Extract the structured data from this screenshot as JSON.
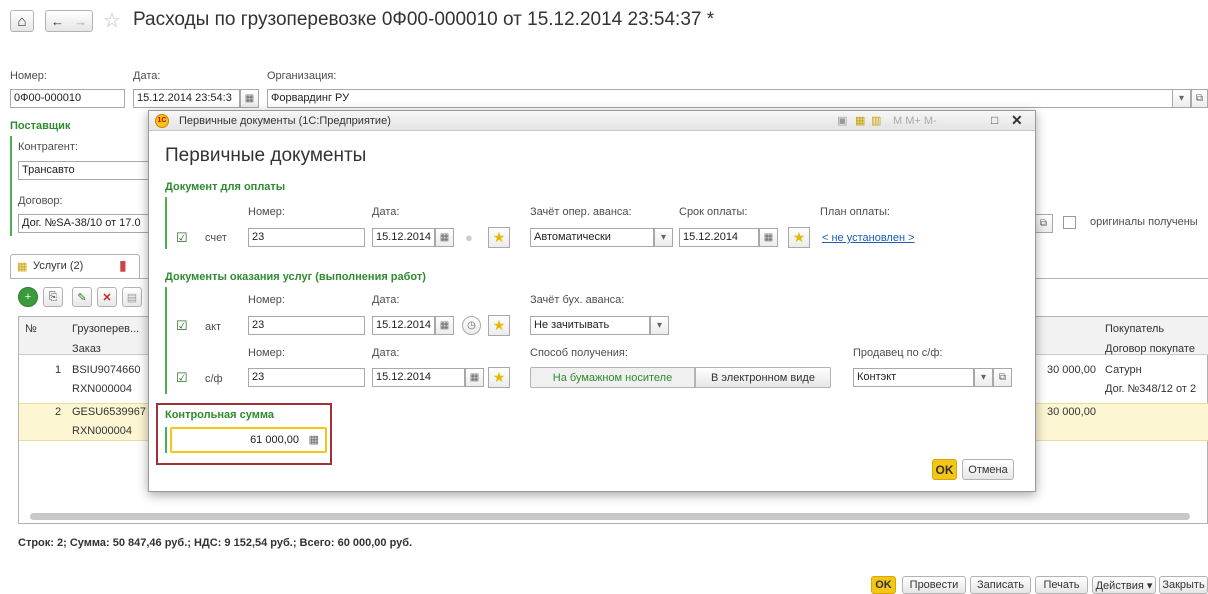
{
  "window": {
    "title": "Расходы по грузоперевозке 0Ф00-000010 от 15.12.2014 23:54:37 *",
    "home_icon": "⌂",
    "back_icon": "←",
    "forward_icon": "→",
    "star_icon": "☆"
  },
  "form": {
    "number_label": "Номер:",
    "number_value": "0Ф00-000010",
    "date_label": "Дата:",
    "date_value": "15.12.2014 23:54:3",
    "org_label": "Организация:",
    "org_value": "Форвардинг РУ",
    "supplier_header": "Поставщик",
    "counterparty_label": "Контрагент:",
    "counterparty_value": "Трансавто",
    "contract_label": "Договор:",
    "contract_value": "Дог. №SA-38/10 от 17.0",
    "originals_label": "оригиналы получены"
  },
  "tabs": [
    {
      "label": "Услуги (2)"
    }
  ],
  "table": {
    "col_num": "№",
    "col_cargo": "Грузоперев...",
    "col_order": "Заказ",
    "col_buyer": "Покупатель",
    "col_buyer_contract": "Договор покупате",
    "rows": [
      {
        "num": "1",
        "cargo": "BSIU9074660",
        "order": "RXN000004",
        "amount": "30 000,00",
        "buyer": "Сатурн",
        "buyer_contract": "Дог. №348/12 от 2"
      },
      {
        "num": "2",
        "cargo": "GESU6539967",
        "order": "RXN000004",
        "amount": "30 000,00",
        "buyer": "",
        "buyer_contract": ""
      }
    ]
  },
  "footer": {
    "totals": "Строк: 2;  Сумма: 50 847,46 руб.;  НДС: 9 152,54 руб.;  Всего: 60 000,00 руб.",
    "ok": "OK",
    "post": "Провести",
    "save": "Записать",
    "print": "Печать",
    "actions": "Действия ▾",
    "close": "Закрыть"
  },
  "dialog": {
    "titlebar": "Первичные документы (1С:Предприятие)",
    "titlebar_tools": "M  M+  M-",
    "heading": "Первичные документы",
    "payment_section": "Документ для оплаты",
    "number_label": "Номер:",
    "date_label": "Дата:",
    "advance_label": "Зачёт опер. аванса:",
    "due_label": "Срок оплаты:",
    "plan_label": "План оплаты:",
    "invoice_type": "счет",
    "invoice_number": "23",
    "invoice_date": "15.12.2014",
    "advance_value": "Автоматически",
    "due_date": "15.12.2014",
    "plan_link": "< не установлен >",
    "services_section": "Документы оказания услуг (выполнения работ)",
    "acc_advance_label": "Зачёт бух. аванса:",
    "act_type": "акт",
    "act_number": "23",
    "act_date": "15.12.2014",
    "acc_advance_value": "Не зачитывать",
    "receive_label": "Способ получения:",
    "seller_label": "Продавец по с/ф:",
    "sf_type": "с/ф",
    "sf_number": "23",
    "sf_date": "15.12.2014",
    "paper_option": "На бумажном носителе",
    "electronic_option": "В электронном виде",
    "seller_value": "Контэкт",
    "checksum_label": "Контрольная сумма",
    "checksum_value": "61 000,00",
    "ok": "OK",
    "cancel": "Отмена"
  },
  "colors": {
    "accent_green": "#2e8b2e",
    "ok_yellow": "#f5c518",
    "highlight_red": "#a0303a",
    "row_selected": "#fdf6d3"
  }
}
